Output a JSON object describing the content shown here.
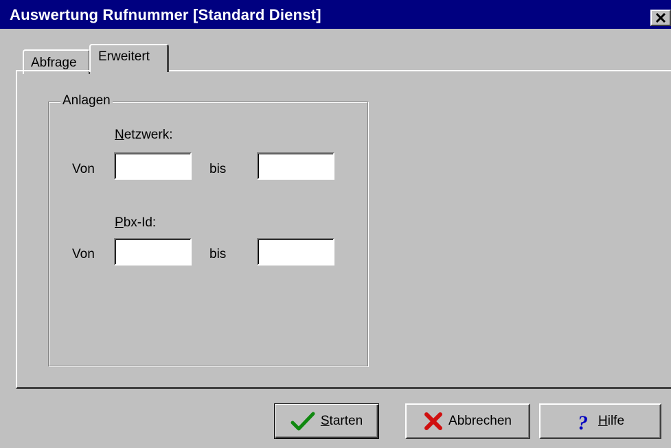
{
  "window": {
    "title": "Auswertung Rufnummer [Standard Dienst]",
    "close_icon": "close-icon"
  },
  "tabs": [
    {
      "label": "Abfrage",
      "active": false
    },
    {
      "label": "Erweitert",
      "active": true
    }
  ],
  "group": {
    "title": "Anlagen",
    "netzwerk": {
      "heading_first": "N",
      "heading_rest": "etzwerk:",
      "von_label": "Von",
      "bis_label": "bis",
      "von_value": "",
      "bis_value": ""
    },
    "pbx": {
      "heading_first": "P",
      "heading_rest": "bx-Id:",
      "von_label": "Von",
      "bis_label": "bis",
      "von_value": "",
      "bis_value": ""
    }
  },
  "buttons": {
    "starten": {
      "mnemonic": "S",
      "rest": "tarten",
      "icon": "checkmark-icon"
    },
    "abbrechen": {
      "label": "Abbrechen",
      "icon": "red-x-icon"
    },
    "hilfe": {
      "mnemonic": "H",
      "rest": "ilfe",
      "icon": "question-mark-icon"
    }
  },
  "colors": {
    "titlebar": "#000080",
    "face": "#c0c0c0",
    "check_green": "#108810",
    "cancel_red": "#d01010",
    "help_blue": "#0000c0"
  }
}
